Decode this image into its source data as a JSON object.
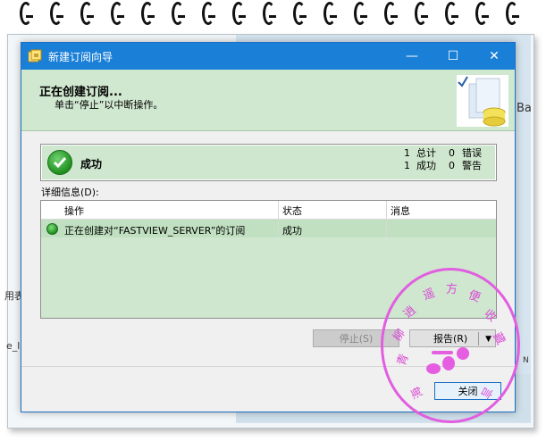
{
  "dialog": {
    "title": "新建订阅向导",
    "header_title": "正在创建订阅...",
    "header_subtitle": "单击“停止”以中断操作。",
    "status_label": "成功",
    "counts": {
      "total_label": "总计",
      "total_value": "1",
      "success_label": "成功",
      "success_value": "1",
      "error_label": "错误",
      "error_value": "0",
      "warning_label": "警告",
      "warning_value": "0"
    },
    "details_label": "详细信息(D):",
    "columns": [
      "操作",
      "状态",
      "消息"
    ],
    "rows": [
      {
        "action": "正在创建对“FASTVIEW_SERVER”的订阅",
        "status": "成功",
        "message": ""
      }
    ],
    "buttons": {
      "stop": "停止(S)",
      "report": "报告(R)",
      "close": "关闭"
    }
  },
  "background": {
    "fragment_right": "Ba",
    "fragment_left1": "用表",
    "fragment_left2": "e_l",
    "fragment_n": "N"
  },
  "stamp": {
    "chars": [
      "青",
      "柳",
      "逍",
      "遥",
      "方",
      "便",
      "收",
      "藏",
      "海",
      "言"
    ]
  },
  "colors": {
    "titlebar": "#1a7fd6",
    "success_green": "#cfe7cf",
    "stamp_pink": "#e25ee0"
  }
}
